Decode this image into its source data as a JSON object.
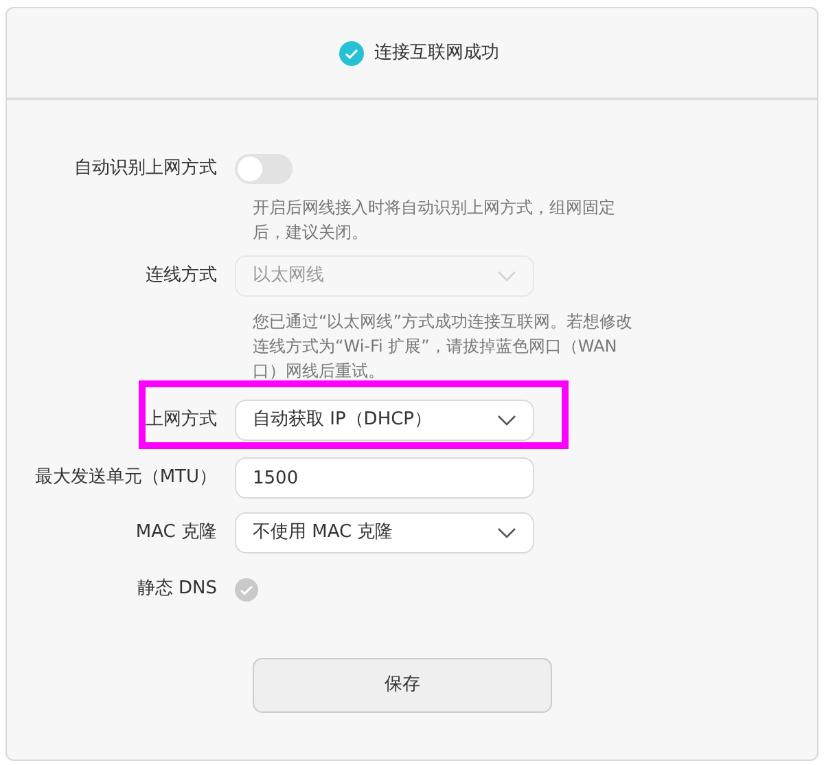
{
  "status": {
    "text": "连接互联网成功",
    "ok": true
  },
  "fields": [
    {
      "kind": "toggle",
      "label": "自动识别上网方式",
      "on": false,
      "hint": "开启后网线接入时将自动识别上网方式，组网固定后，建议关闭。"
    },
    {
      "kind": "select",
      "label": "连线方式",
      "value": "以太网线",
      "disabled": true,
      "hint": "您已通过“以太网线”方式成功连接互联网。若想修改连线方式为“Wi-Fi 扩展”，请拔掉蓝色网口（WAN口）网线后重试。"
    },
    {
      "kind": "select",
      "label": "上网方式",
      "value": "自动获取 IP（DHCP）",
      "disabled": false,
      "highlighted": true
    },
    {
      "kind": "text",
      "label": "最大发送单元（MTU）",
      "value": "1500"
    },
    {
      "kind": "select",
      "label": "MAC 克隆",
      "value": "不使用 MAC 克隆",
      "disabled": false
    },
    {
      "kind": "check",
      "label": "静态 DNS",
      "checked": true,
      "disabled": true
    }
  ],
  "save_button": "保存"
}
